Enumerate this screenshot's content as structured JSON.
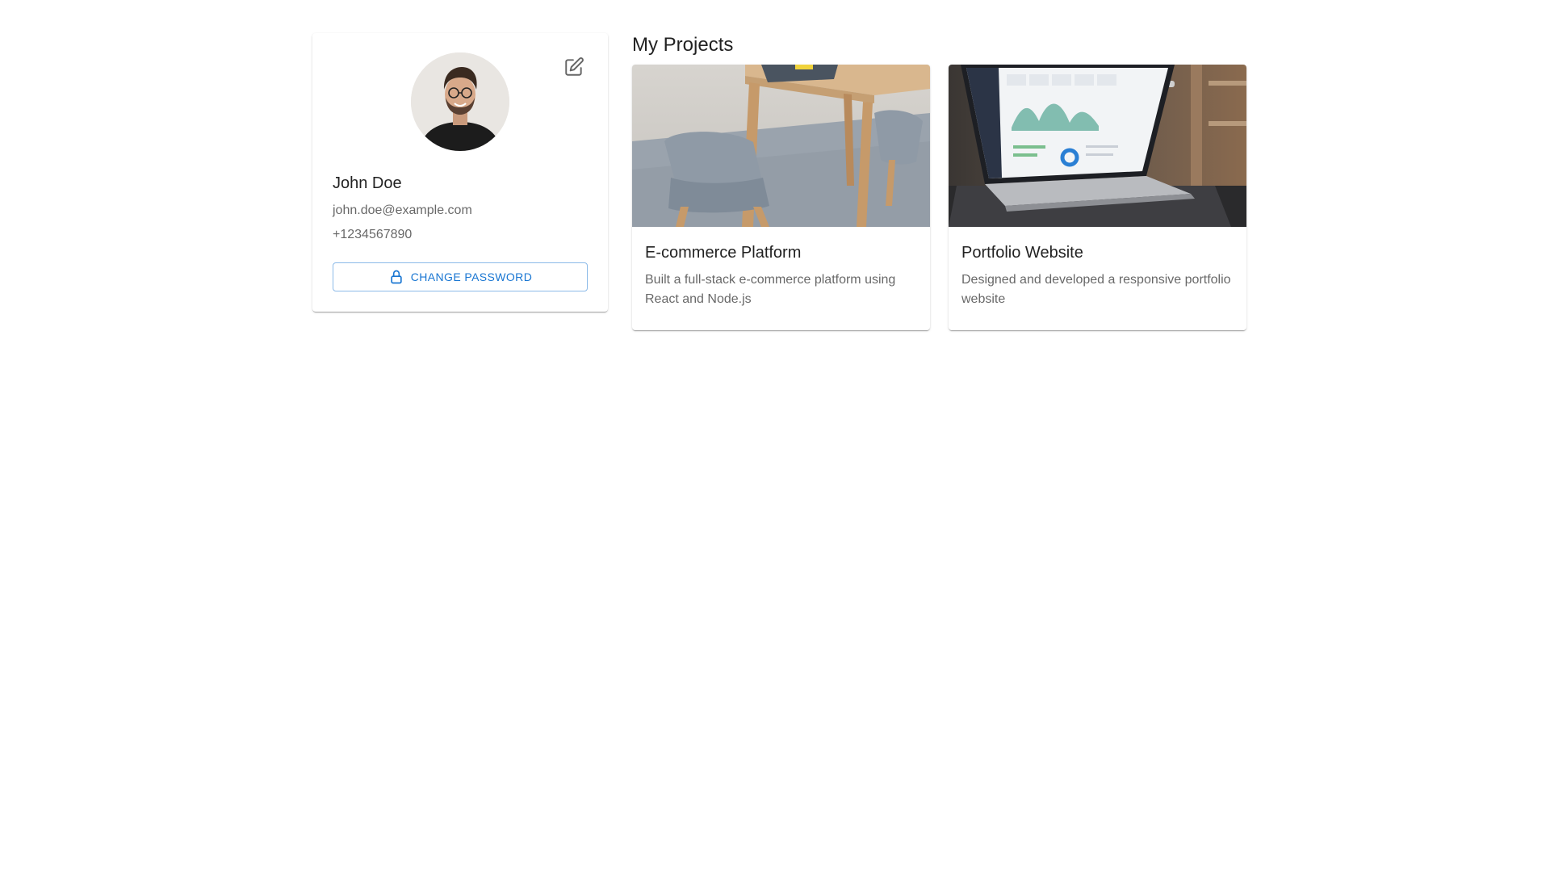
{
  "profile": {
    "name": "John Doe",
    "email": "john.doe@example.com",
    "phone": "+1234567890",
    "change_password_label": "CHANGE PASSWORD",
    "edit_icon": "edit-icon",
    "lock_icon": "lock-icon"
  },
  "projects": {
    "section_title": "My Projects",
    "items": [
      {
        "title": "E-commerce Platform",
        "description": "Built a full-stack e-commerce platform using React and Node.js"
      },
      {
        "title": "Portfolio Website",
        "description": "Designed and developed a responsive portfolio website"
      }
    ]
  },
  "colors": {
    "primary": "#1976d2",
    "text_primary": "rgba(0,0,0,0.87)",
    "text_secondary": "rgba(0,0,0,0.6)"
  }
}
